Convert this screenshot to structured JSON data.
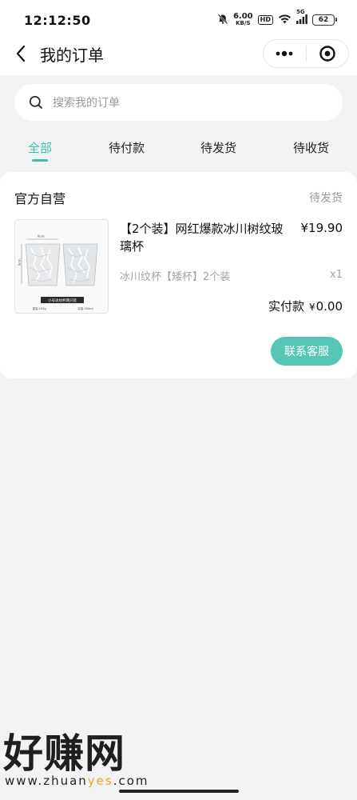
{
  "status_bar": {
    "time": "12:12:50",
    "net_speed_value": "6.00",
    "net_speed_unit": "KB/S",
    "hd_label": "HD",
    "signal_label": "5G",
    "battery": "62"
  },
  "nav": {
    "title": "我的订单",
    "back_icon": "chevron-left-icon",
    "more_icon": "more-dots-icon",
    "close_icon": "target-circle-icon"
  },
  "search": {
    "placeholder": "搜索我的订单"
  },
  "tabs": [
    {
      "label": "全部",
      "active": true
    },
    {
      "label": "待付款",
      "active": false
    },
    {
      "label": "待发货",
      "active": false
    },
    {
      "label": "待收货",
      "active": false
    }
  ],
  "order": {
    "shop_name": "官方自营",
    "status": "待发货",
    "product": {
      "title": "【2个装】网红爆款冰川树纹玻璃杯",
      "price": "¥19.90",
      "spec": "冰川纹杯【矮杯】2个装",
      "quantity": "x1",
      "image_caption": "小号冰纹杯两只装",
      "image_dim_top": "9cm",
      "image_dim_side": "9cm",
      "image_weight": "重量:205g",
      "image_capacity": "容量:300ml"
    },
    "paid_label": "实付款",
    "paid_currency": "¥",
    "paid_amount": "0.00",
    "contact_button": "联系客服"
  },
  "watermark": {
    "logo": "好赚网",
    "url_prefix": "www.zhuan",
    "url_highlight": "yes",
    "url_suffix": ".com"
  },
  "colors": {
    "accent": "#3fbfae",
    "button": "#56c7b5",
    "background": "#f2f3f5"
  }
}
